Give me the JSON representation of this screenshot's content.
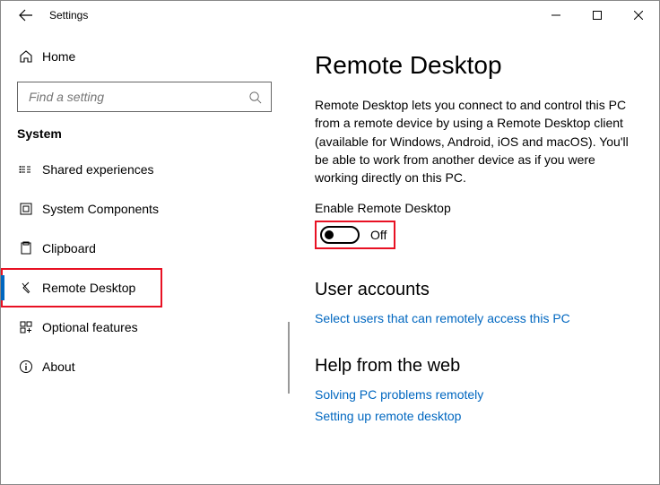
{
  "window": {
    "title": "Settings"
  },
  "sidebar": {
    "home": "Home",
    "search_placeholder": "Find a setting",
    "section_label": "System",
    "items": [
      {
        "label": "Shared experiences"
      },
      {
        "label": "System Components"
      },
      {
        "label": "Clipboard"
      },
      {
        "label": "Remote Desktop"
      },
      {
        "label": "Optional features"
      },
      {
        "label": "About"
      }
    ],
    "selected_index": 3
  },
  "content": {
    "heading": "Remote Desktop",
    "description": "Remote Desktop lets you connect to and control this PC from a remote device by using a Remote Desktop client (available for Windows, Android, iOS and macOS). You'll be able to work from another device as if you were working directly on this PC.",
    "toggle_label": "Enable Remote Desktop",
    "toggle_state": "Off",
    "user_accounts_heading": "User accounts",
    "user_accounts_link": "Select users that can remotely access this PC",
    "help_heading": "Help from the web",
    "help_links": [
      "Solving PC problems remotely",
      "Setting up remote desktop"
    ]
  }
}
